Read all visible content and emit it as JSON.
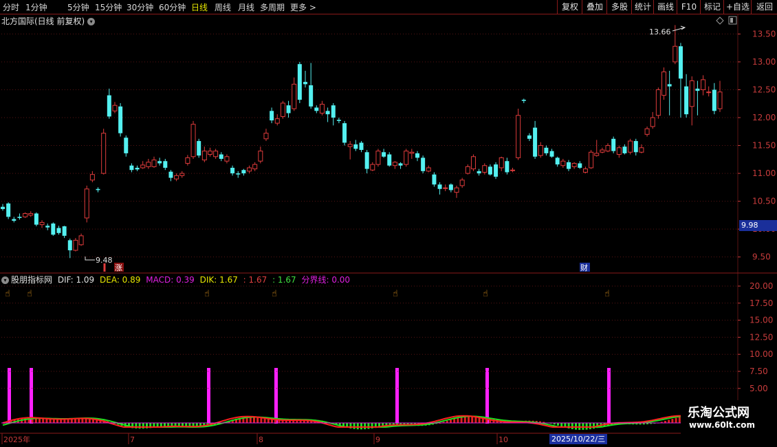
{
  "toolbar": {
    "periods": [
      "分时",
      "1分钟",
      "5分钟",
      "15分钟",
      "30分钟",
      "60分钟",
      "日线",
      "周线",
      "月线",
      "多周期",
      "更多 >"
    ],
    "active_period": "日线",
    "right_buttons": [
      "复权",
      "叠加",
      "多股",
      "统计",
      "画线",
      "F10",
      "标记",
      "+自选",
      "返回"
    ]
  },
  "chart_header": {
    "title": "北方国际(日线 前复权)",
    "toggle_icon": "chevron-down-icon"
  },
  "price_axis": {
    "ticks": [
      "13.50",
      "13.00",
      "12.50",
      "12.00",
      "11.50",
      "11.00",
      "10.50",
      "10.00",
      "9.50"
    ],
    "current_price": "9.98"
  },
  "annotations": {
    "high": "13.66",
    "low": "9.48",
    "rise_badge": "涨",
    "finance_badge": "财"
  },
  "indicator": {
    "name": "股朋指标网",
    "values": [
      {
        "text": "DIF: 1.09",
        "color": "#e0e0e0"
      },
      {
        "text": "DEA: 0.89",
        "color": "#e8e800"
      },
      {
        "text": "MACD: 0.39",
        "color": "#e020e0"
      },
      {
        "text": "DIK: 1.67",
        "color": "#e8e800"
      },
      {
        "text": ": 1.67",
        "color": "#e04040"
      },
      {
        "text": ": 1.67",
        "color": "#40e040"
      },
      {
        "text": "分界线: 0.00",
        "color": "#e020e0"
      }
    ],
    "axis_ticks": [
      "20.00",
      "17.50",
      "15.00",
      "12.50",
      "10.00",
      "7.50",
      "5.00"
    ],
    "signal_icon": "pointing-hand-icon"
  },
  "date_axis": {
    "labels": [
      "2025年",
      "7",
      "8",
      "9",
      "10"
    ],
    "current_date": "2025/10/22/三"
  },
  "watermark": {
    "line1": "乐淘公式网",
    "line2": "www.60lt.com"
  },
  "colors": {
    "up": "#e03c3c",
    "down": "#54f0f0",
    "grid": "#5a1414",
    "signal": "#ff20ff",
    "dif_line": "#ff2020",
    "dea_line": "#20e020"
  },
  "chart_data": {
    "type": "candlestick",
    "title": "北方国际(日线 前复权)",
    "y_range": [
      9.2,
      13.9
    ],
    "high_label": 13.66,
    "low_label": 9.48,
    "candles": [
      [
        10.4,
        10.36,
        10.45,
        10.33
      ],
      [
        10.46,
        10.22,
        10.48,
        10.18
      ],
      [
        10.18,
        10.15,
        10.22,
        10.12
      ],
      [
        10.22,
        10.2,
        10.28,
        10.17
      ],
      [
        10.22,
        10.28,
        10.3,
        10.2
      ],
      [
        10.25,
        10.28,
        10.32,
        10.22
      ],
      [
        10.28,
        10.08,
        10.3,
        10.05
      ],
      [
        10.08,
        10.12,
        10.16,
        10.02
      ],
      [
        10.06,
        10.03,
        10.1,
        9.98
      ],
      [
        10.1,
        9.9,
        10.12,
        9.88
      ],
      [
        10.02,
        9.93,
        10.06,
        9.9
      ],
      [
        10.05,
        9.88,
        10.06,
        9.84
      ],
      [
        9.8,
        9.62,
        9.83,
        9.48
      ],
      [
        9.62,
        9.8,
        9.84,
        9.6
      ],
      [
        9.72,
        9.88,
        9.92,
        9.7
      ],
      [
        10.2,
        10.72,
        10.78,
        10.12
      ],
      [
        10.88,
        10.98,
        11.04,
        10.84
      ],
      [
        10.72,
        10.7,
        10.75,
        10.66
      ],
      [
        11.0,
        11.72,
        11.8,
        10.98
      ],
      [
        12.4,
        12.02,
        12.52,
        11.98
      ],
      [
        12.12,
        12.22,
        12.28,
        12.08
      ],
      [
        12.2,
        11.72,
        12.26,
        11.66
      ],
      [
        11.64,
        11.36,
        11.68,
        11.3
      ],
      [
        11.14,
        11.06,
        11.18,
        11.02
      ],
      [
        11.1,
        11.07,
        11.14,
        11.04
      ],
      [
        11.1,
        11.15,
        11.22,
        11.08
      ],
      [
        11.12,
        11.2,
        11.26,
        11.08
      ],
      [
        11.12,
        11.24,
        11.3,
        11.1
      ],
      [
        11.22,
        11.18,
        11.28,
        11.14
      ],
      [
        11.22,
        11.1,
        11.26,
        11.06
      ],
      [
        11.03,
        10.92,
        11.06,
        10.86
      ],
      [
        10.9,
        10.96,
        11.0,
        10.86
      ],
      [
        10.96,
        11.0,
        11.04,
        10.92
      ],
      [
        11.18,
        11.28,
        11.33,
        11.14
      ],
      [
        11.3,
        11.88,
        11.94,
        11.26
      ],
      [
        11.58,
        11.32,
        11.62,
        11.28
      ],
      [
        11.24,
        11.4,
        11.48,
        11.2
      ],
      [
        11.34,
        11.4,
        11.46,
        11.3
      ],
      [
        11.3,
        11.4,
        11.44,
        11.26
      ],
      [
        11.34,
        11.26,
        11.38,
        11.22
      ],
      [
        11.22,
        11.3,
        11.34,
        11.18
      ],
      [
        11.1,
        11.0,
        11.14,
        10.96
      ],
      [
        11.0,
        10.98,
        11.04,
        10.92
      ],
      [
        11.06,
        11.0,
        11.08,
        10.96
      ],
      [
        11.04,
        11.1,
        11.14,
        11.0
      ],
      [
        11.08,
        11.16,
        11.2,
        11.04
      ],
      [
        11.22,
        11.4,
        11.48,
        11.18
      ],
      [
        11.62,
        11.72,
        11.8,
        11.58
      ],
      [
        12.12,
        11.95,
        12.18,
        11.9
      ],
      [
        11.9,
        11.98,
        12.06,
        11.86
      ],
      [
        12.02,
        12.26,
        12.3,
        11.98
      ],
      [
        12.22,
        12.08,
        12.3,
        12.0
      ],
      [
        12.16,
        12.6,
        12.72,
        12.12
      ],
      [
        12.96,
        12.32,
        13.0,
        12.26
      ],
      [
        12.64,
        12.6,
        12.84,
        12.54
      ],
      [
        12.58,
        12.2,
        12.98,
        12.16
      ],
      [
        12.18,
        12.12,
        12.22,
        12.08
      ],
      [
        12.08,
        12.24,
        12.3,
        12.04
      ],
      [
        12.12,
        12.06,
        12.18,
        11.92
      ],
      [
        12.22,
        12.0,
        12.26,
        11.86
      ],
      [
        11.96,
        11.94,
        12.0,
        11.9
      ],
      [
        11.9,
        11.55,
        11.94,
        11.5
      ],
      [
        11.48,
        11.52,
        11.58,
        11.25
      ],
      [
        11.52,
        11.44,
        11.6,
        11.4
      ],
      [
        11.55,
        11.42,
        11.58,
        11.38
      ],
      [
        11.38,
        11.08,
        11.42,
        11.0
      ],
      [
        11.06,
        11.16,
        11.2,
        11.04
      ],
      [
        11.16,
        11.4,
        11.44,
        11.12
      ],
      [
        11.38,
        11.3,
        11.44,
        11.28
      ],
      [
        11.34,
        11.14,
        11.38,
        11.12
      ],
      [
        11.14,
        11.2,
        11.22,
        11.08
      ],
      [
        11.18,
        11.14,
        11.2,
        11.08
      ],
      [
        11.16,
        11.4,
        11.44,
        11.12
      ],
      [
        11.36,
        11.38,
        11.44,
        11.26
      ],
      [
        11.36,
        11.28,
        11.4,
        11.22
      ],
      [
        11.28,
        11.04,
        11.32,
        11.0
      ],
      [
        11.04,
        11.1,
        11.14,
        11.02
      ],
      [
        10.98,
        10.8,
        11.02,
        10.76
      ],
      [
        10.8,
        10.72,
        10.84,
        10.62
      ],
      [
        10.74,
        10.74,
        10.8,
        10.68
      ],
      [
        10.8,
        10.7,
        10.82,
        10.66
      ],
      [
        10.66,
        10.74,
        10.78,
        10.56
      ],
      [
        10.78,
        10.88,
        10.92,
        10.74
      ],
      [
        11.0,
        11.12,
        11.16,
        10.98
      ],
      [
        11.08,
        11.3,
        11.34,
        11.04
      ],
      [
        11.04,
        11.0,
        11.08,
        10.96
      ],
      [
        11.02,
        11.14,
        11.18,
        10.98
      ],
      [
        11.12,
        10.98,
        11.16,
        10.96
      ],
      [
        11.16,
        10.94,
        11.2,
        10.9
      ],
      [
        11.1,
        11.28,
        11.3,
        11.04
      ],
      [
        11.22,
        11.02,
        11.28,
        10.98
      ],
      [
        11.06,
        11.06,
        11.1,
        11.02
      ],
      [
        11.28,
        12.04,
        12.16,
        11.24
      ],
      [
        12.32,
        12.3,
        12.34,
        12.26
      ],
      [
        11.68,
        11.62,
        11.72,
        11.58
      ],
      [
        11.82,
        11.3,
        11.94,
        11.26
      ],
      [
        11.32,
        11.5,
        11.56,
        11.28
      ],
      [
        11.46,
        11.36,
        11.5,
        11.32
      ],
      [
        11.4,
        11.3,
        11.44,
        11.28
      ],
      [
        11.28,
        11.16,
        11.3,
        11.12
      ],
      [
        11.14,
        11.22,
        11.26,
        11.1
      ],
      [
        11.2,
        11.08,
        11.24,
        11.04
      ],
      [
        11.12,
        11.18,
        11.2,
        11.08
      ],
      [
        11.18,
        11.1,
        11.22,
        11.08
      ],
      [
        11.02,
        11.08,
        11.12,
        11.0
      ],
      [
        11.1,
        11.38,
        11.42,
        11.08
      ],
      [
        11.32,
        11.36,
        11.6,
        11.3
      ],
      [
        11.38,
        11.42,
        11.46,
        11.36
      ],
      [
        11.4,
        11.5,
        11.54,
        11.38
      ],
      [
        11.62,
        11.4,
        11.66,
        11.36
      ],
      [
        11.34,
        11.46,
        11.5,
        11.28
      ],
      [
        11.48,
        11.36,
        11.52,
        11.34
      ],
      [
        11.38,
        11.58,
        11.62,
        11.34
      ],
      [
        11.58,
        11.38,
        11.62,
        11.32
      ],
      [
        11.38,
        11.46,
        11.52,
        11.36
      ],
      [
        11.7,
        11.8,
        11.84,
        11.66
      ],
      [
        11.84,
        12.0,
        12.1,
        11.8
      ],
      [
        12.04,
        12.5,
        12.54,
        11.98
      ],
      [
        12.4,
        12.82,
        12.9,
        12.32
      ],
      [
        12.6,
        12.56,
        12.84,
        12.04
      ],
      [
        13.0,
        13.28,
        13.66,
        12.96
      ],
      [
        13.28,
        12.7,
        13.34,
        12.0
      ],
      [
        12.56,
        12.06,
        12.78,
        12.0
      ],
      [
        12.2,
        12.66,
        12.74,
        11.86
      ],
      [
        12.52,
        12.48,
        12.66,
        12.04
      ],
      [
        12.5,
        12.68,
        12.76,
        12.4
      ],
      [
        12.46,
        12.46,
        12.56,
        12.38
      ],
      [
        12.5,
        12.12,
        12.62,
        12.06
      ],
      [
        12.16,
        12.46,
        12.66,
        12.1
      ]
    ]
  }
}
